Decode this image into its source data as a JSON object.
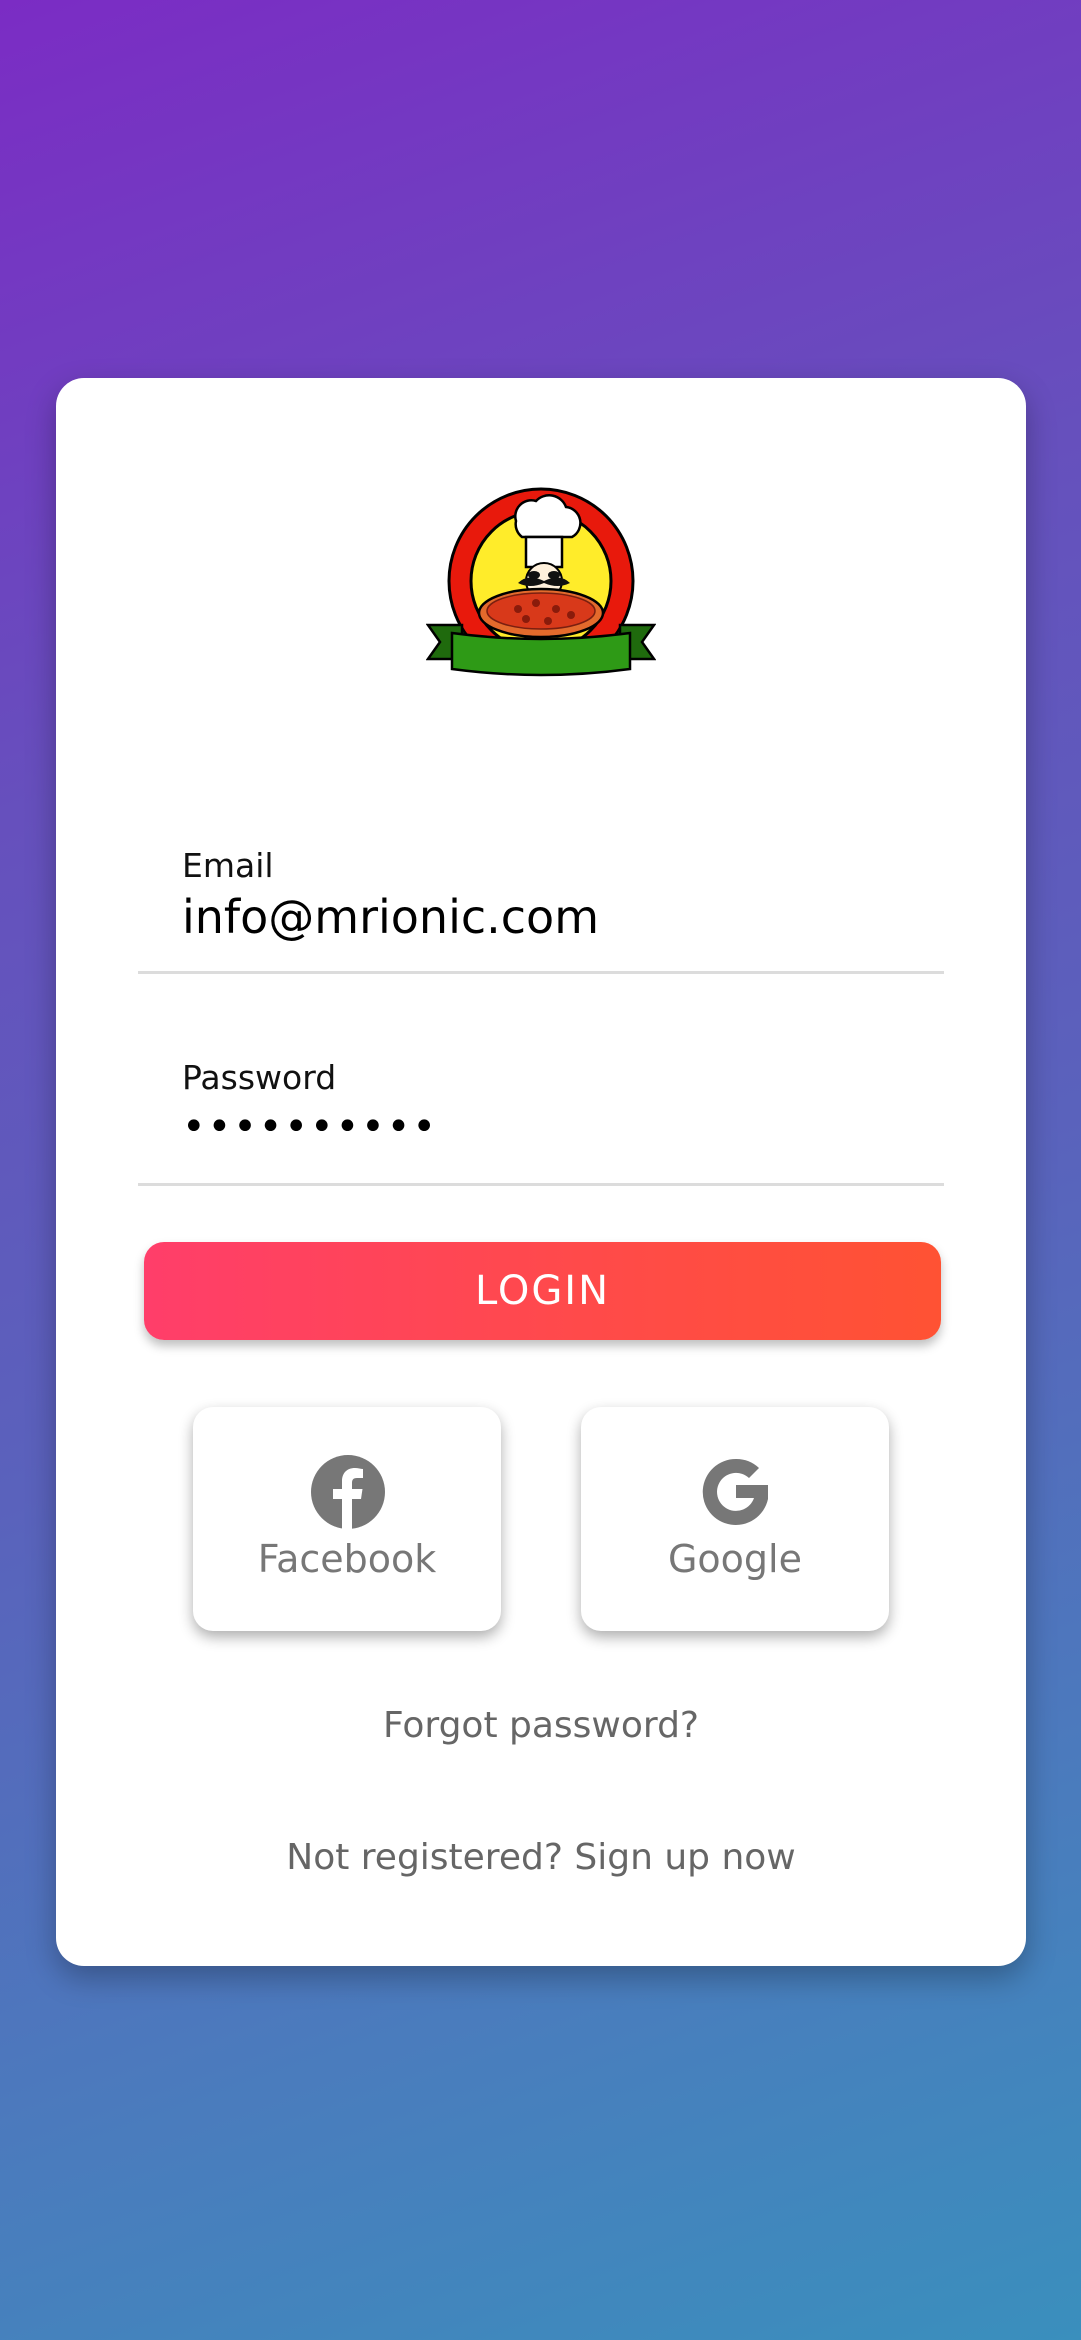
{
  "brand": {
    "logo_icon": "pizza-chef-icon"
  },
  "form": {
    "email": {
      "label": "Email",
      "value": "info@mrionic.com"
    },
    "password": {
      "label": "Password",
      "value": "••••••••••"
    }
  },
  "login_label": "LOGIN",
  "social": [
    {
      "label": "Facebook",
      "icon": "facebook-icon"
    },
    {
      "label": "Google",
      "icon": "google-icon"
    }
  ],
  "links": {
    "forgot": "Forgot password?",
    "signup": "Not registered? Sign up now"
  },
  "colors": {
    "login_gradient_start": "#ff3e6a",
    "login_gradient_end": "#ff5233",
    "social_icon": "#777777"
  }
}
